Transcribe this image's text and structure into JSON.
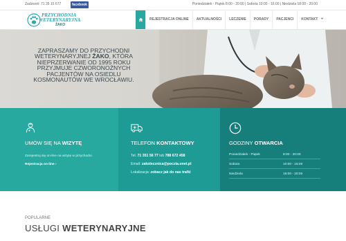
{
  "topbar": {
    "phone": "Zadzwoń: 71 35 15 677",
    "facebook_label": "facebook",
    "hours": "Poniedziałek - Piątek 8:00 - 20:00 | Sobota 10:00 - 16:00 | Niedziela 18:00 - 20:00"
  },
  "logo": {
    "line1": "PRZYCHODNIA",
    "line2": "WETERYNARYJNA",
    "line3": "ŻAKO"
  },
  "nav": {
    "home_icon": "home-icon",
    "items": [
      "REJESTRACJA ONLINE",
      "AKTUALNOŚCI",
      "LECZENIE",
      "PORADY",
      "PACJENCI",
      "KONTAKT"
    ],
    "kontakt_chevron": "chevron-down-icon"
  },
  "hero": {
    "text_before": "ZAPRASZAMY DO PRZYCHODNI WETERYNARYJNEJ ",
    "text_brand": "ŻAKO",
    "text_after": ", KTÓRA NIEPRZERWANIE OD 1995 ROKU PRZYJMUJE CZWORONOŻNYCH PACJENTÓW NA OSIEDLU KOSMONAUTÓW WE WROCŁAWIU."
  },
  "appointment": {
    "icon": "vet-doctor-icon",
    "title_light": "UMÓW SIĘ NA ",
    "title_bold": "WIZYTĘ",
    "text": "Zarejestruj się on-line na wizytę w przychodni.",
    "link": "Rejestracja on-line",
    "link_icon": "chevron-right-icon"
  },
  "contact": {
    "icon": "ambulance-icon",
    "title_light": "TELEFON ",
    "title_bold": "KONTAKTOWY",
    "tel_label": "Tel. ",
    "tel_value": "71 351 56 77",
    "tel_or": " lub ",
    "tel_value2": "788 672 458",
    "email_label": "Email: ",
    "email_value": "zakolecznica@poczta.onet.pl",
    "location_label": "Lokalizacja: ",
    "location_value": "zobacz jak do nas trafić"
  },
  "hours": {
    "icon": "clock-icon",
    "title_light": "GODZINY ",
    "title_bold": "OTWARCIA",
    "rows": [
      {
        "day": "Poniedziałek - Piątek",
        "time": "8:00 - 20:00"
      },
      {
        "day": "Sobota",
        "time": "10:00 - 16:00"
      },
      {
        "day": "Niedziela",
        "time": "18:00 - 20:00"
      }
    ]
  },
  "services": {
    "eyebrow": "POPULARNE",
    "title_light": "USŁUGI ",
    "title_bold": "WETERYNARYJNE"
  },
  "colors": {
    "teal_1": "#27a9a0",
    "teal_2": "#1f9b95",
    "teal_3": "#167f7c",
    "facebook": "#3b5998",
    "logo": "#27a9b5"
  }
}
